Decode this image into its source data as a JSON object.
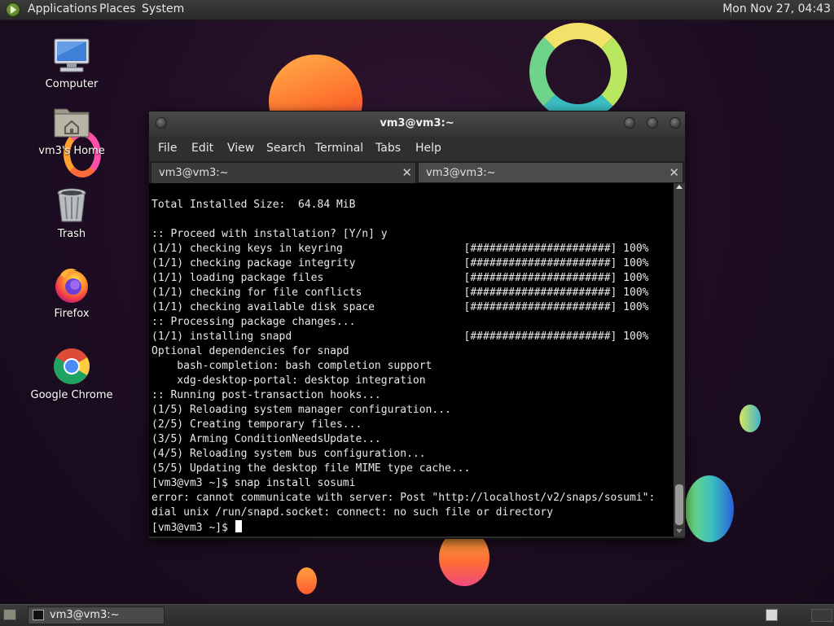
{
  "top_panel": {
    "applications": "Applications",
    "places": "Places",
    "system": "System",
    "clock": "Mon Nov 27, 04:43"
  },
  "desktop_icons": [
    {
      "label": "Computer",
      "icon": "computer-icon"
    },
    {
      "label": "vm3's Home",
      "icon": "home-folder-icon"
    },
    {
      "label": "Trash",
      "icon": "trash-icon"
    },
    {
      "label": "Firefox",
      "icon": "firefox-icon"
    },
    {
      "label": "Google Chrome",
      "icon": "chrome-icon"
    }
  ],
  "window": {
    "title": "vm3@vm3:~",
    "menu": [
      "File",
      "Edit",
      "View",
      "Search",
      "Terminal",
      "Tabs",
      "Help"
    ],
    "tabs": [
      {
        "label": "vm3@vm3:~",
        "active": true
      },
      {
        "label": "vm3@vm3:~",
        "active": false
      }
    ],
    "terminal_lines": [
      "Total Installed Size:  64.84 MiB",
      "",
      ":: Proceed with installation? [Y/n] y",
      "(1/1) checking keys in keyring                   [######################] 100%",
      "(1/1) checking package integrity                 [######################] 100%",
      "(1/1) loading package files                      [######################] 100%",
      "(1/1) checking for file conflicts                [######################] 100%",
      "(1/1) checking available disk space              [######################] 100%",
      ":: Processing package changes...",
      "(1/1) installing snapd                           [######################] 100%",
      "Optional dependencies for snapd",
      "    bash-completion: bash completion support",
      "    xdg-desktop-portal: desktop integration",
      ":: Running post-transaction hooks...",
      "(1/5) Reloading system manager configuration...",
      "(2/5) Creating temporary files...",
      "(3/5) Arming ConditionNeedsUpdate...",
      "(4/5) Reloading system bus configuration...",
      "(5/5) Updating the desktop file MIME type cache...",
      "[vm3@vm3 ~]$ snap install sosumi",
      "error: cannot communicate with server: Post \"http://localhost/v2/snaps/sosumi\":",
      "dial unix /run/snapd.socket: connect: no such file or directory"
    ],
    "prompt": "[vm3@vm3 ~]$ "
  },
  "taskbar": {
    "task_label": "vm3@vm3:~"
  }
}
